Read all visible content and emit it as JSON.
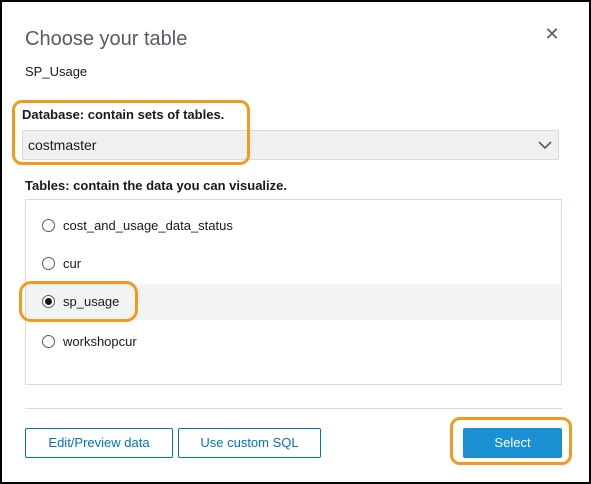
{
  "dialog": {
    "title": "Choose your table",
    "subtitle": "SP_Usage",
    "close_icon": "close-icon"
  },
  "database": {
    "label": "Database: contain sets of tables.",
    "selected": "costmaster",
    "chevron_icon": "chevron-down-icon"
  },
  "tables": {
    "label": "Tables: contain the data you can visualize.",
    "items": [
      {
        "label": "cost_and_usage_data_status",
        "selected": false
      },
      {
        "label": "cur",
        "selected": false
      },
      {
        "label": "sp_usage",
        "selected": true
      },
      {
        "label": "workshopcur",
        "selected": false
      }
    ]
  },
  "buttons": {
    "edit_preview": "Edit/Preview data",
    "custom_sql": "Use custom SQL",
    "select": "Select"
  },
  "colors": {
    "highlight": "#f39a1e",
    "primary": "#1a8fd1",
    "link": "#0073bb"
  }
}
